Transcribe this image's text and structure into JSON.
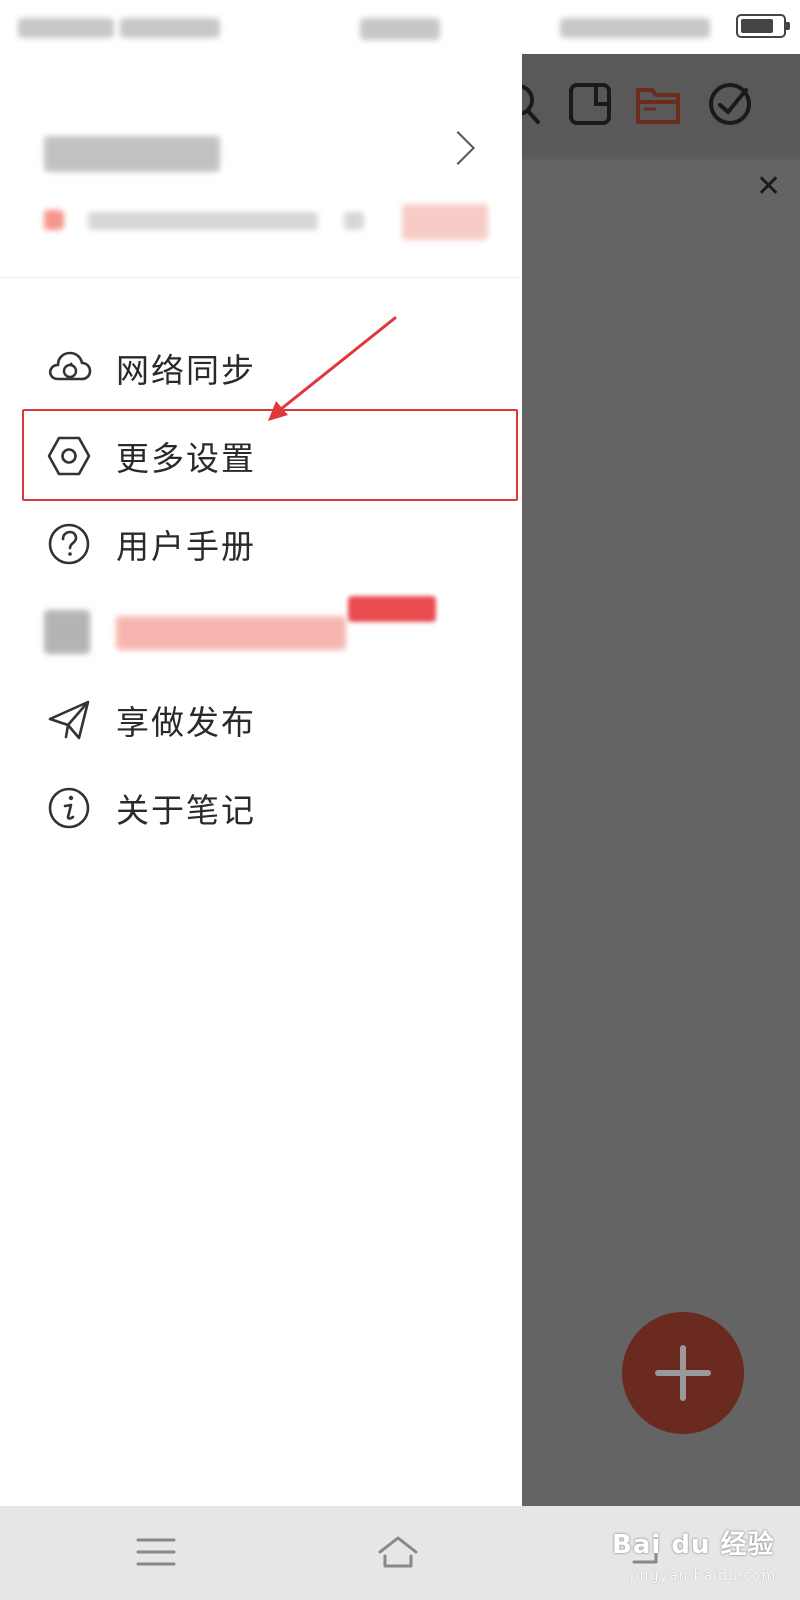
{
  "menu": {
    "items": [
      {
        "label": "网络同步",
        "icon": "cloud-sync-icon"
      },
      {
        "label": "更多设置",
        "icon": "hexagon-settings-icon"
      },
      {
        "label": "用户手册",
        "icon": "question-circle-icon"
      },
      {
        "label": "",
        "icon": "store-icon"
      },
      {
        "label": "享做发布",
        "icon": "send-icon"
      },
      {
        "label": "关于笔记",
        "icon": "info-circle-icon"
      }
    ]
  },
  "watermark": {
    "brand": "Bai du 经验",
    "site": "jingyan.baidu.com"
  },
  "colors": {
    "accent": "#c4552f",
    "highlight": "#e0373a",
    "overlay": "#646464",
    "fab": "#6a2a1f"
  }
}
